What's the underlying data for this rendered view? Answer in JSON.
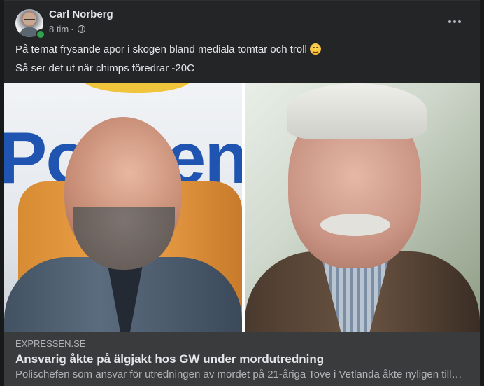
{
  "post": {
    "author": "Carl Norberg",
    "time": "8 tim",
    "separator": "·",
    "lines": [
      "På temat frysande apor i skogen bland mediala tomtar och troll",
      "Så ser det ut när chimps föredrar -20C"
    ],
    "emoji": "winking-face",
    "audience_icon": "globe-icon",
    "menu_icon": "more-options-icon"
  },
  "link": {
    "domain": "EXPRESSEN.SE",
    "title": "Ansvarig åkte på älgjakt hos GW under mordutredning",
    "description": "Polischefen som ansvar för utredningen av mordet på 21-åriga Tove i Vetlanda åkte nyligen till jakt hos GW Persson…"
  },
  "image": {
    "logo_text": "Polisen"
  },
  "colors": {
    "card_bg": "#242526",
    "link_footer_bg": "#3a3b3c",
    "primary_text": "#e4e6eb",
    "secondary_text": "#b0b3b8",
    "online": "#31a24c"
  }
}
